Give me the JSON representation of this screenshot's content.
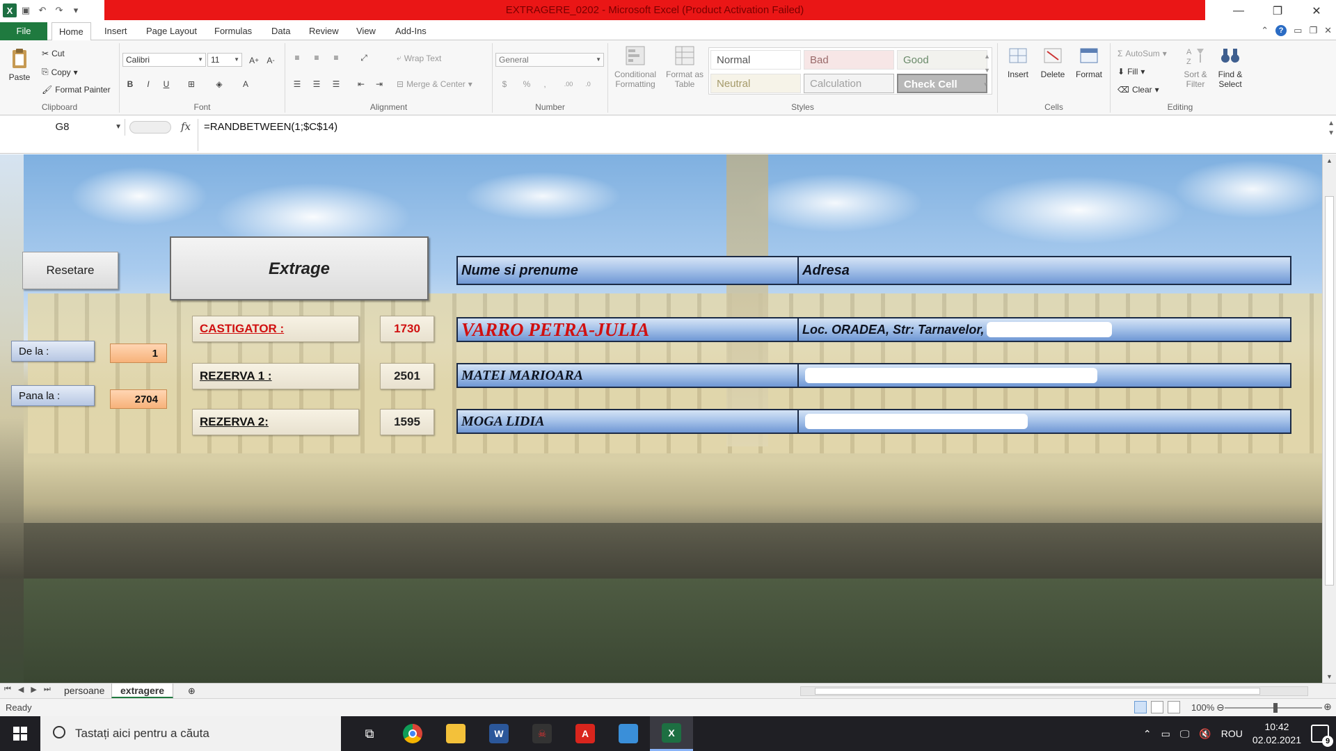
{
  "window": {
    "title": "EXTRAGERE_0202  -  Microsoft Excel (Product Activation Failed)"
  },
  "ribbon_tabs": [
    "File",
    "Home",
    "Insert",
    "Page Layout",
    "Formulas",
    "Data",
    "Review",
    "View",
    "Add-Ins"
  ],
  "ribbon": {
    "clipboard": {
      "label": "Clipboard",
      "paste": "Paste",
      "cut": "Cut",
      "copy": "Copy",
      "format_painter": "Format Painter"
    },
    "font": {
      "label": "Font",
      "font_name": "Calibri",
      "font_size": "11"
    },
    "alignment": {
      "label": "Alignment",
      "wrap_text": "Wrap Text",
      "merge_center": "Merge & Center"
    },
    "number": {
      "label": "Number",
      "format": "General"
    },
    "styles": {
      "label": "Styles",
      "conditional_formatting": "Conditional Formatting",
      "format_as_table": "Format as Table",
      "normal": "Normal",
      "bad": "Bad",
      "good": "Good",
      "neutral": "Neutral",
      "calculation": "Calculation",
      "check_cell": "Check Cell"
    },
    "cells": {
      "label": "Cells",
      "insert": "Insert",
      "delete": "Delete",
      "format": "Format"
    },
    "editing": {
      "label": "Editing",
      "autosum": "AutoSum",
      "fill": "Fill",
      "clear": "Clear",
      "sort_filter": "Sort & Filter",
      "find_select": "Find & Select"
    }
  },
  "formula_bar": {
    "name_box": "G8",
    "formula": "=RANDBETWEEN(1;$C$14)"
  },
  "sheet": {
    "reset_button": "Resetare",
    "extract_button": "Extrage",
    "range": {
      "from_label": "De la :",
      "from_value": "1",
      "to_label": "Pana la :",
      "to_value": "2704"
    },
    "winners": [
      {
        "label": "CASTIGATOR :",
        "number": "1730",
        "name": "VARRO PETRA-JULIA",
        "address": "Loc. ORADEA, Str: Tarnavelor,"
      },
      {
        "label": "REZERVA 1 :",
        "number": "2501",
        "name": "MATEI MARIOARA",
        "address": ""
      },
      {
        "label": "REZERVA 2:",
        "number": "1595",
        "name": "MOGA LIDIA",
        "address": ""
      }
    ],
    "table_headers": {
      "name": "Nume si prenume",
      "address": "Adresa"
    }
  },
  "sheet_tabs": [
    "persoane",
    "extragere"
  ],
  "status": {
    "ready": "Ready",
    "zoom": "100%"
  },
  "taskbar": {
    "search_placeholder": "Tastați aici pentru a căuta",
    "language": "ROU",
    "time": "10:42",
    "date": "02.02.2021",
    "notifications": "9"
  },
  "colors": {
    "accent": "#1f7a3f",
    "title_strip": "#ea1616",
    "winner_red": "#d01010"
  }
}
